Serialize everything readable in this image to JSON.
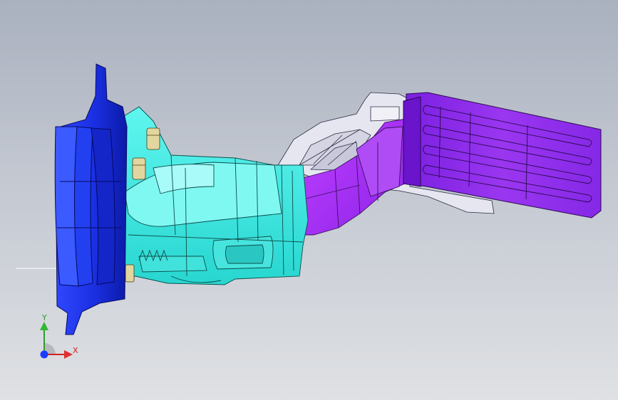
{
  "viewport": {
    "background_top": "#aab1bf",
    "background_bottom": "#dfe1e4"
  },
  "model": {
    "flange_color": "#1a2fe0",
    "housing_color": "#33e6e0",
    "pedal_arm_color": "#a020f0",
    "pedal_pad_color": "#8a2be2",
    "bracket_color": "#e4e4ee",
    "bolt_color": "#e2d6a0"
  },
  "triad": {
    "x_label": "X",
    "y_label": "Y",
    "x_color": "#d42020",
    "y_color": "#2e9c2e",
    "z_color": "#1a3cff",
    "icons": [
      "x-axis-arrow-icon",
      "y-axis-arrow-icon",
      "z-axis-dot-icon"
    ]
  }
}
